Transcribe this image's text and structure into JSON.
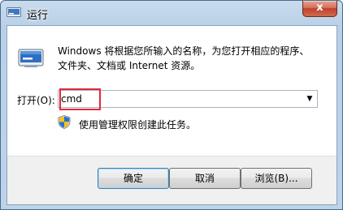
{
  "window": {
    "title": "运行",
    "close_label": "x"
  },
  "run": {
    "description_line1": "Windows 将根据您所输入的名称，为您打开相应的程序、",
    "description_line2": "文件夹、文档或 Internet 资源。",
    "open_label": "打开(O):",
    "command_value": "cmd",
    "admin_note": "使用管理权限创建此任务。"
  },
  "buttons": {
    "ok": "确定",
    "cancel": "取消",
    "browse": "浏览(B)..."
  },
  "icons": {
    "title": "run-icon",
    "main": "run-icon",
    "shield": "uac-shield-icon",
    "dropdown": "chevron-down-icon"
  },
  "colors": {
    "highlight_box": "#e0283c",
    "close_button": "#c0402a"
  }
}
